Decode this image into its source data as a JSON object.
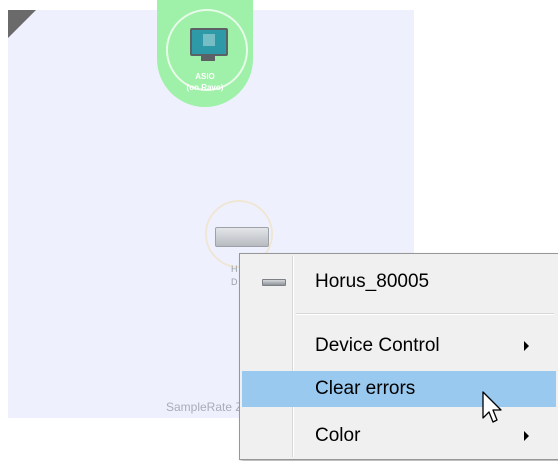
{
  "canvas": {
    "zone_label": "SampleRate Zon"
  },
  "asio_node": {
    "name": "ASIO",
    "subtitle": "(on Ravo)"
  },
  "horus_node": {
    "label_line1": "H",
    "label_line2": "D"
  },
  "context_menu": {
    "device_name": "Horus_80005",
    "items": [
      {
        "label": "Device Control",
        "has_submenu": true
      },
      {
        "label": "Clear errors",
        "has_submenu": false,
        "highlighted": true
      },
      {
        "label": "Color",
        "has_submenu": true
      }
    ]
  },
  "colors": {
    "zone_background": "#eef1fd",
    "asio_highlight": "#9ff0a8",
    "menu_highlight": "#99c9ef",
    "menu_background": "#f0f0f0"
  },
  "icons": {
    "corner": "corner-triangle-icon",
    "asio": "computer-monitor-icon",
    "horus": "audio-interface-icon",
    "menu_device": "device-icon",
    "cursor": "mouse-pointer-icon"
  }
}
